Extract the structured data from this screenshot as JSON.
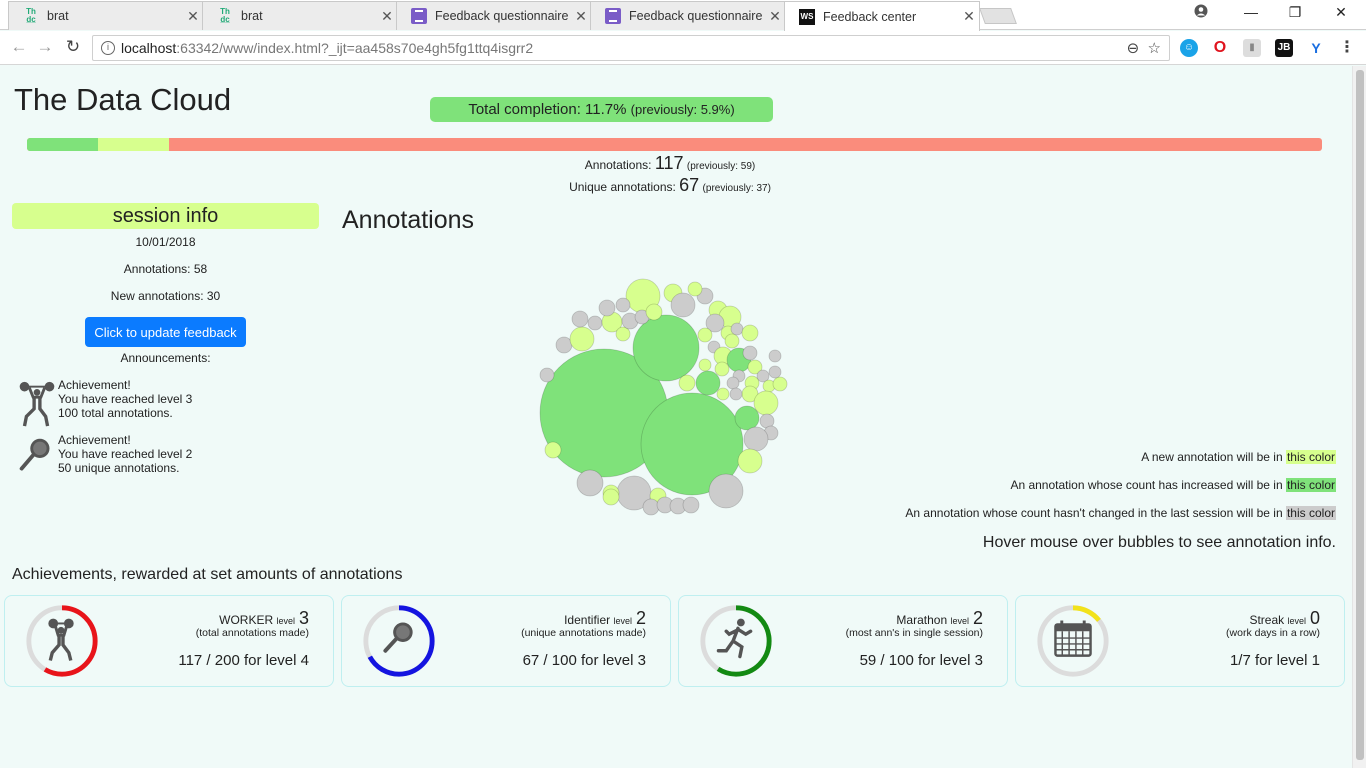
{
  "browser": {
    "tabs": [
      {
        "title": "brat",
        "icon": "brat-logo-icon"
      },
      {
        "title": "brat",
        "icon": "brat-logo-icon"
      },
      {
        "title": "Feedback questionnaire",
        "icon": "forms-icon"
      },
      {
        "title": "Feedback questionnaire",
        "icon": "forms-icon"
      },
      {
        "title": "Feedback center",
        "icon": "webstorm-icon",
        "active": true
      }
    ],
    "url_host": "localhost",
    "url_rest": ":63342/www/index.html?_ijt=aa458s70e4gh5fg1ttq4isgrr2"
  },
  "header": {
    "title": "The Data Cloud",
    "total_completion": "Total completion: 11.7%",
    "total_previous": "(previously: 5.9%)",
    "progress": {
      "green": 0.055,
      "light": 0.055,
      "red": 0.89
    }
  },
  "counts": {
    "annotations_label": "Annotations:",
    "annotations_value": "117",
    "annotations_prev": "(previously: 59)",
    "unique_label": "Unique annotations:",
    "unique_value": "67",
    "unique_prev": "(previously: 37)"
  },
  "session": {
    "heading": "session info",
    "date": "10/01/2018",
    "annotations": "Annotations: 58",
    "new_annotations": "New annotations: 30",
    "update_button": "Click to update feedback",
    "announcements_label": "Announcements:",
    "announcements": [
      {
        "icon": "weightlifter-icon",
        "lines": [
          "Achievement!",
          "You have reached level 3",
          "100 total annotations."
        ]
      },
      {
        "icon": "magnifier-icon",
        "lines": [
          "Achievement!",
          "You have reached level 2",
          "50 unique annotations."
        ]
      }
    ]
  },
  "annotations": {
    "title": "Annotations",
    "colors": {
      "new": "#d7ff8e",
      "increased": "#7fe27a",
      "unchanged": "#cccccc"
    },
    "legend": [
      {
        "text": "A new annotation will be in",
        "swatch": "this color",
        "color": "#d7ff8e"
      },
      {
        "text": "An annotation whose count has increased will be in",
        "swatch": "this color",
        "color": "#7fe27a"
      },
      {
        "text": "An annotation whose count hasn't changed in the last session will be in",
        "swatch": "this color",
        "color": "#cccccc"
      }
    ],
    "hover_hint": "Hover mouse over bubbles to see annotation info."
  },
  "achievements": {
    "heading": "Achievements, rewarded at set amounts of annotations",
    "cards": [
      {
        "name": "WORKER",
        "level_word": "level",
        "level": "3",
        "subtitle": "(total annotations made)",
        "goal": "117 / 200 for level 4",
        "color": "#e8141a",
        "fraction": 0.585,
        "icon": "weightlifter-icon"
      },
      {
        "name": "Identifier",
        "level_word": "level",
        "level": "2",
        "subtitle": "(unique annotations made)",
        "goal": "67 / 100 for level 3",
        "color": "#1414e0",
        "fraction": 0.67,
        "icon": "magnifier-icon"
      },
      {
        "name": "Marathon",
        "level_word": "level",
        "level": "2",
        "subtitle": "(most ann's in single session)",
        "goal": "59 / 100 for level 3",
        "color": "#138a13",
        "fraction": 0.59,
        "icon": "runner-icon"
      },
      {
        "name": "Streak",
        "level_word": "level",
        "level": "0",
        "subtitle": "(work days in a row)",
        "goal": "1/7 for level 1",
        "color": "#f2e21a",
        "fraction": 0.143,
        "icon": "calendar-icon"
      }
    ]
  }
}
